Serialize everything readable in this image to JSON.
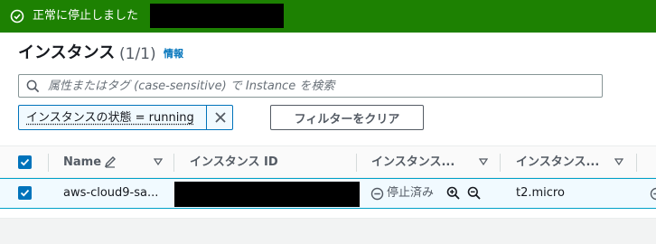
{
  "banner": {
    "message": "正常に停止しました",
    "status_color": "#1d8102"
  },
  "header": {
    "title": "インスタンス",
    "count": "(1/1)",
    "info_link": "情報"
  },
  "search": {
    "placeholder": "属性またはタグ (case-sensitive) で Instance を検索",
    "value": ""
  },
  "filters": {
    "active_token": "インスタンスの状態 = running",
    "clear_button": "フィルターをクリア"
  },
  "table": {
    "columns": [
      {
        "label": "Name"
      },
      {
        "label": "インスタンス ID"
      },
      {
        "label": "インスタンス..."
      },
      {
        "label": "インスタンス..."
      }
    ],
    "rows": [
      {
        "selected": true,
        "name": "aws-cloud9-sa...",
        "state": "停止済み",
        "type": "t2.micro"
      }
    ]
  },
  "colors": {
    "accent": "#0073bb",
    "selected_row": "#f1faff"
  }
}
